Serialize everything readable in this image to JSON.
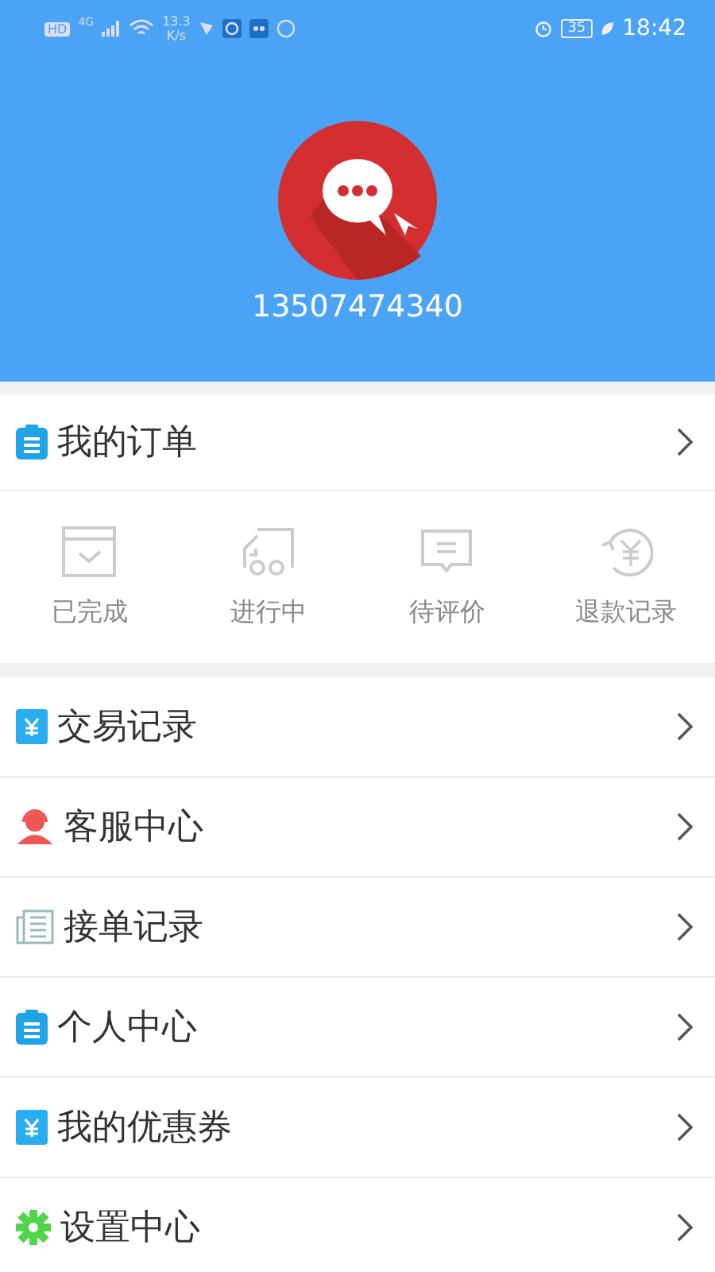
{
  "status_bar": {
    "left": [
      "HD",
      "4G"
    ],
    "speed": [
      "13.3",
      "K/s"
    ],
    "battery": "35",
    "time": "18:42"
  },
  "profile": {
    "phone": "13507474340"
  },
  "orders": {
    "title": "我的订单",
    "statuses": [
      {
        "label": "已完成",
        "kind": "done"
      },
      {
        "label": "进行中",
        "kind": "truck"
      },
      {
        "label": "待评价",
        "kind": "comment"
      },
      {
        "label": "退款记录",
        "kind": "refund"
      }
    ]
  },
  "menu": [
    {
      "label": "交易记录",
      "kind": "yen"
    },
    {
      "label": "客服中心",
      "kind": "agent"
    },
    {
      "label": "接单记录",
      "kind": "news"
    },
    {
      "label": "个人中心",
      "kind": "clipboard"
    },
    {
      "label": "我的优惠券",
      "kind": "yen"
    },
    {
      "label": "设置中心",
      "kind": "gear"
    }
  ]
}
